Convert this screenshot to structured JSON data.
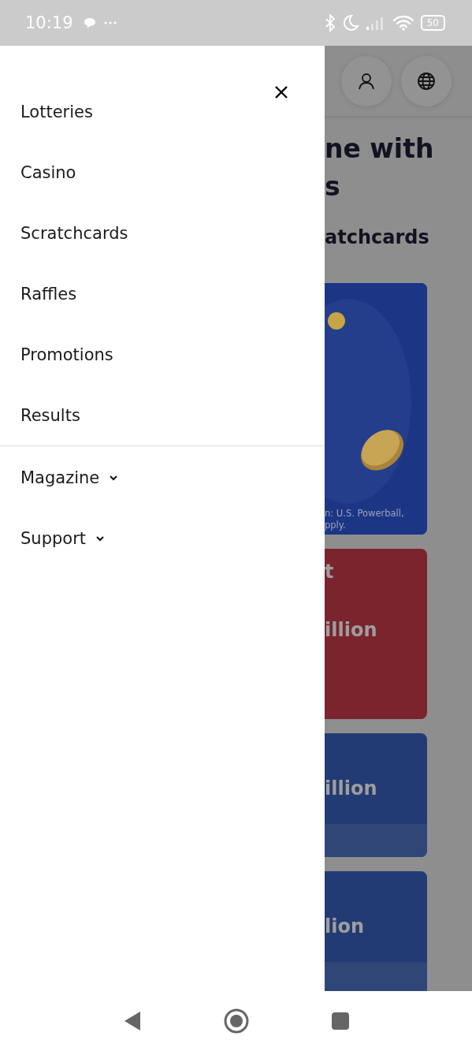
{
  "status_bar": {
    "time": "10:19",
    "battery": "50"
  },
  "drawer": {
    "items": [
      {
        "label": "Lotteries",
        "kind": "link"
      },
      {
        "label": "Casino",
        "kind": "link"
      },
      {
        "label": "Scratchcards",
        "kind": "link"
      },
      {
        "label": "Raffles",
        "kind": "link"
      },
      {
        "label": "Promotions",
        "kind": "link"
      },
      {
        "label": "Results",
        "kind": "link"
      },
      {
        "label": "Magazine",
        "kind": "dropdown",
        "expanded": false
      },
      {
        "label": "Support",
        "kind": "dropdown",
        "expanded": false
      }
    ]
  },
  "background_page": {
    "heading_lines": [
      "ne with",
      "s"
    ],
    "subheading": "atchcards",
    "cards": [
      {
        "kind": "picture",
        "color": "#1c3585",
        "lines": [
          "n: U.S. Powerball,",
          "pply."
        ],
        "footer": false
      },
      {
        "kind": "jackpot",
        "color": "#7b242e",
        "lines": [
          "t",
          "illion"
        ],
        "footer": false
      },
      {
        "kind": "jackpot",
        "color": "#233b74",
        "lines": [
          "illion"
        ],
        "footer": true
      },
      {
        "kind": "jackpot",
        "color": "#233b74",
        "lines": [
          "lion"
        ],
        "footer": true
      }
    ]
  }
}
